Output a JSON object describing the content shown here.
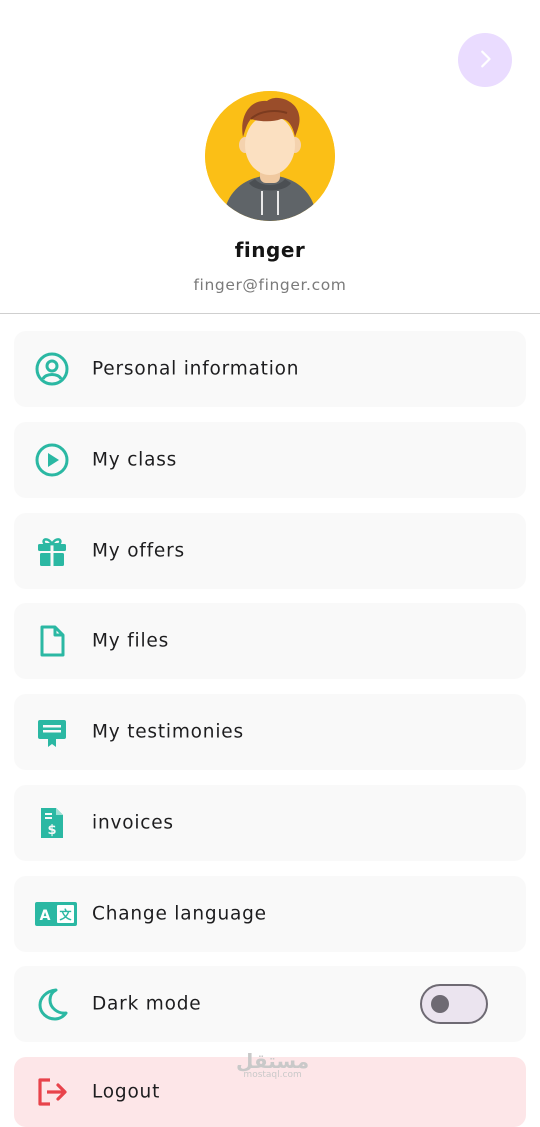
{
  "profile": {
    "name": "finger",
    "email": "finger@finger.com"
  },
  "header": {
    "next_icon": "chevron-right-icon"
  },
  "menu": {
    "items": [
      {
        "label": "Personal information",
        "icon": "user-circle-icon"
      },
      {
        "label": "My class",
        "icon": "play-circle-icon"
      },
      {
        "label": "My offers",
        "icon": "gift-icon"
      },
      {
        "label": "My files",
        "icon": "file-icon"
      },
      {
        "label": "My testimonies",
        "icon": "certificate-icon"
      },
      {
        "label": "invoices",
        "icon": "invoice-dollar-icon"
      },
      {
        "label": "Change language",
        "icon": "translate-icon"
      },
      {
        "label": "Dark mode",
        "icon": "moon-icon",
        "toggle": "off"
      }
    ],
    "logout": {
      "label": "Logout",
      "icon": "logout-icon"
    }
  },
  "colors": {
    "accent": "#2bb8a3",
    "logout": "#e8434b",
    "avatar_bg": "#fbbf16",
    "next_button_bg": "#eadcff"
  },
  "watermark": {
    "arabic": "مستقل",
    "latin": "mostaql.com"
  }
}
